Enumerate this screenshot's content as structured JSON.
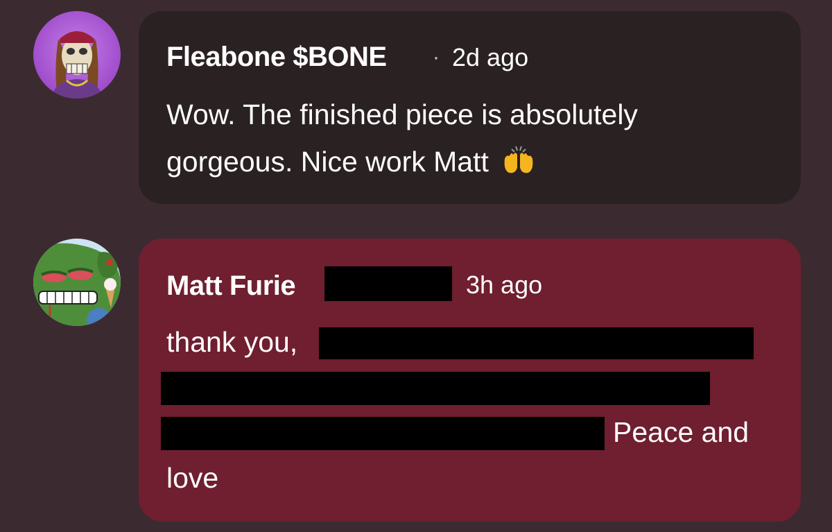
{
  "comments": [
    {
      "author": "Fleabone $BONE",
      "separator": "·",
      "time": "2d ago",
      "body_line1": "Wow. The finished piece is absolutely",
      "body_line2": "gorgeous. Nice work Matt",
      "emoji": "raising-hands-emoji",
      "avatar": "skeleton-avatar-icon"
    },
    {
      "author": "Matt Furie",
      "time": "3h ago",
      "body_line1": "thank you,",
      "body_line3_end": "Peace and",
      "body_line4": "love",
      "avatar": "frog-avatar-icon"
    }
  ],
  "colors": {
    "background": "#3b2b30",
    "bubble_1": "#2a2123",
    "bubble_2": "#6f1f2f",
    "redaction": "#000000"
  }
}
